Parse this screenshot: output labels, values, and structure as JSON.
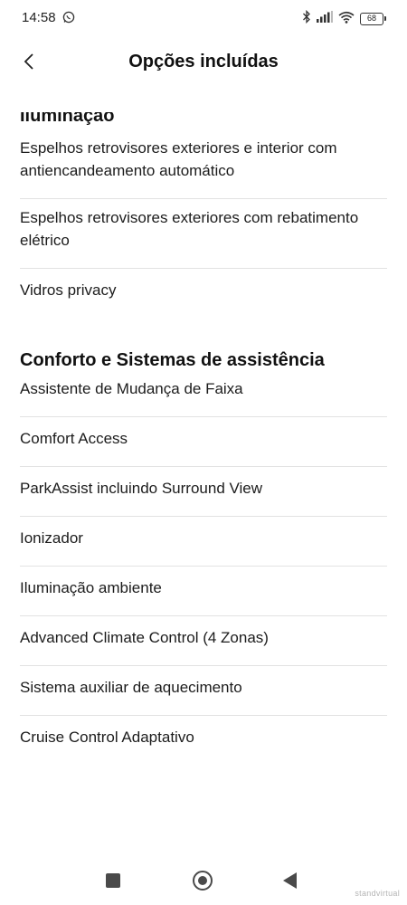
{
  "status_bar": {
    "time": "14:58",
    "battery": "68"
  },
  "header": {
    "title": "Opções incluídas"
  },
  "sections": [
    {
      "title": "Iluminação",
      "items": [
        "Espelhos retrovisores exteriores e interior com antiencandeamento automático",
        "Espelhos retrovisores exteriores com rebatimento elétrico",
        "Vidros privacy"
      ]
    },
    {
      "title": "Conforto e Sistemas de assistência",
      "items": [
        "Assistente de Mudança de Faixa",
        "Comfort Access",
        "ParkAssist incluindo Surround View",
        "Ionizador",
        "Iluminação ambiente",
        "Advanced Climate Control (4 Zonas)",
        "Sistema auxiliar de aquecimento",
        "Cruise Control Adaptativo"
      ]
    }
  ],
  "watermark": "standvirtual"
}
